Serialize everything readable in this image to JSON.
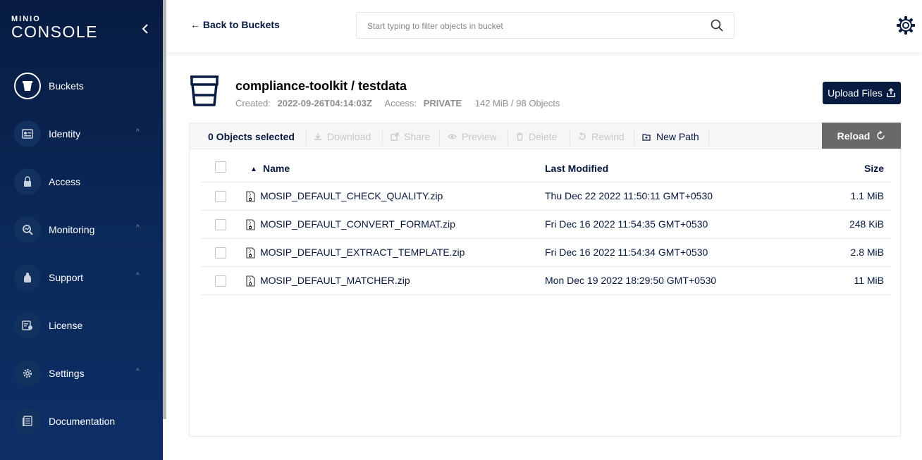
{
  "sidebar": {
    "logo_mini": "MINIO",
    "logo_title": "CONSOLE",
    "items": [
      {
        "label": "Buckets",
        "icon": "bucket-icon",
        "active": true
      },
      {
        "label": "Identity",
        "icon": "identity-icon",
        "caret": true
      },
      {
        "label": "Access",
        "icon": "lock-icon"
      },
      {
        "label": "Monitoring",
        "icon": "monitoring-icon",
        "caret": true
      },
      {
        "label": "Support",
        "icon": "support-icon",
        "caret": true
      },
      {
        "label": "License",
        "icon": "license-icon"
      },
      {
        "label": "Settings",
        "icon": "gear-icon",
        "caret": true
      },
      {
        "label": "Documentation",
        "icon": "documentation-icon"
      }
    ]
  },
  "header": {
    "back_label": "Back to Buckets",
    "search_placeholder": "Start typing to filter objects in bucket"
  },
  "bucket": {
    "title": "compliance-toolkit / testdata",
    "created_label": "Created:",
    "created_value": "2022-09-26T04:14:03Z",
    "access_label": "Access:",
    "access_value": "PRIVATE",
    "usage": "142 MiB / 98 Objects",
    "upload_label": "Upload Files"
  },
  "toolbar": {
    "selected": "0 Objects selected",
    "download": "Download",
    "share": "Share",
    "preview": "Preview",
    "delete": "Delete",
    "rewind": "Rewind",
    "new_path": "New Path",
    "reload": "Reload"
  },
  "table": {
    "headers": {
      "name": "Name",
      "modified": "Last Modified",
      "size": "Size"
    },
    "rows": [
      {
        "name": "MOSIP_DEFAULT_CHECK_QUALITY.zip",
        "modified": "Thu Dec 22 2022 11:50:11 GMT+0530",
        "size": "1.1 MiB"
      },
      {
        "name": "MOSIP_DEFAULT_CONVERT_FORMAT.zip",
        "modified": "Fri Dec 16 2022 11:54:35 GMT+0530",
        "size": "248 KiB"
      },
      {
        "name": "MOSIP_DEFAULT_EXTRACT_TEMPLATE.zip",
        "modified": "Fri Dec 16 2022 11:54:34 GMT+0530",
        "size": "2.8 MiB"
      },
      {
        "name": "MOSIP_DEFAULT_MATCHER.zip",
        "modified": "Mon Dec 19 2022 18:29:50 GMT+0530",
        "size": "11 MiB"
      }
    ]
  },
  "colors": {
    "sidebar": "#081c42",
    "accent": "#081c42",
    "reload": "#696969"
  }
}
